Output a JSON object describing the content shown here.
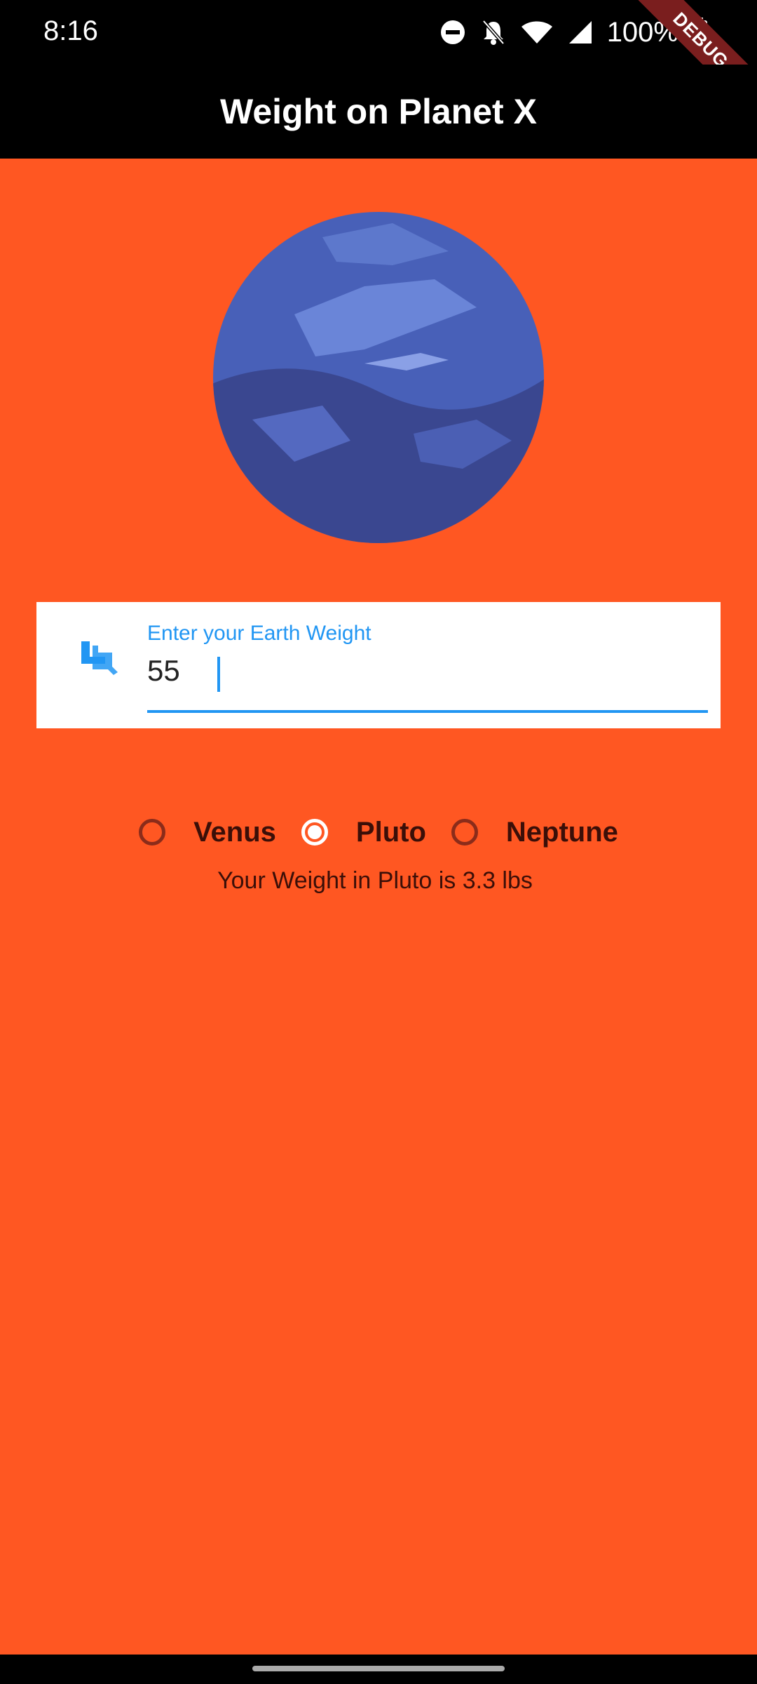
{
  "status_bar": {
    "time": "8:16",
    "battery": "100%",
    "icons": [
      "dnd-icon",
      "bell-off-icon",
      "wifi-icon",
      "signal-icon",
      "battery-icon"
    ]
  },
  "debug_banner": "DEBUG",
  "app_bar": {
    "title": "Weight on Planet X"
  },
  "input": {
    "label": "Enter your Earth Weight",
    "value": "55",
    "icon": "weight-icon",
    "accent_color": "#2196f3"
  },
  "radios": [
    {
      "label": "Venus",
      "selected": false
    },
    {
      "label": "Pluto",
      "selected": true
    },
    {
      "label": "Neptune",
      "selected": false
    }
  ],
  "result": "Your Weight in Pluto is 3.3 lbs",
  "colors": {
    "background": "#ff5722",
    "app_bar": "#000000",
    "planet": "#3f51b5"
  }
}
